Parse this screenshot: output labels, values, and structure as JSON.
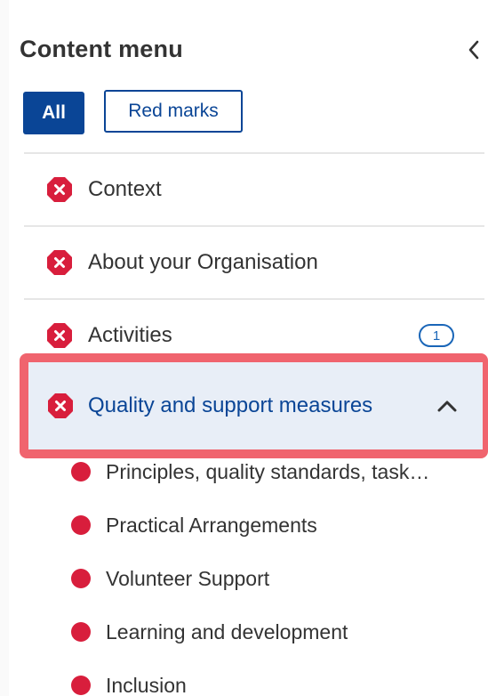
{
  "panel": {
    "title": "Content menu",
    "collapse_icon": "chevron-left-icon"
  },
  "filters": {
    "all_label": "All",
    "red_marks_label": "Red marks",
    "selected": "All"
  },
  "menu": {
    "items": [
      {
        "label": "Context",
        "status": "error"
      },
      {
        "label": "About your Organisation",
        "status": "error"
      },
      {
        "label": "Activities",
        "status": "error",
        "badge": "1"
      },
      {
        "label": "Quality and support measures",
        "status": "error",
        "expanded": true
      }
    ],
    "sub_items": [
      {
        "label": "Principles, quality standards, task…"
      },
      {
        "label": "Practical Arrangements"
      },
      {
        "label": "Volunteer Support"
      },
      {
        "label": "Learning and development"
      },
      {
        "label": "Inclusion"
      }
    ]
  },
  "colors": {
    "primary": "#0a4596",
    "error": "#d81e3c",
    "highlight_border": "#f0646e",
    "active_bg": "#e8eef7",
    "badge": "#1a66b8"
  }
}
